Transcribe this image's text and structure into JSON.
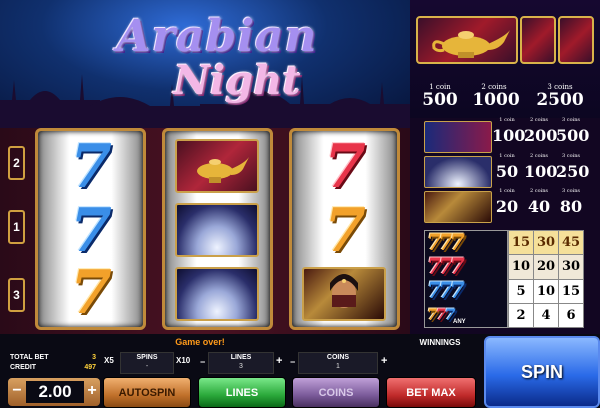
{
  "logo": {
    "line1": "Arabian",
    "line2": "Night"
  },
  "paytable_top": {
    "symbol": "magic-lamp",
    "payouts": [
      {
        "label": "1 coin",
        "value": "500"
      },
      {
        "label": "2 coins",
        "value": "1000"
      },
      {
        "label": "3 coins",
        "value": "2500"
      }
    ]
  },
  "paytable_rows": [
    {
      "symbol": "flying-carpet",
      "labels": [
        "1 coin",
        "2 coins",
        "3 coins"
      ],
      "values": [
        "100",
        "200",
        "500"
      ]
    },
    {
      "symbol": "arch",
      "labels": [
        "1 coin",
        "2 coins",
        "3 coins"
      ],
      "values": [
        "50",
        "100",
        "250"
      ]
    },
    {
      "symbol": "princess",
      "labels": [
        "1 coin",
        "2 coins",
        "3 coins"
      ],
      "values": [
        "20",
        "40",
        "80"
      ]
    }
  ],
  "sevens_table": {
    "rows": [
      {
        "values": [
          "15",
          "30",
          "45"
        ]
      },
      {
        "values": [
          "10",
          "20",
          "30"
        ]
      },
      {
        "values": [
          "5",
          "10",
          "15"
        ]
      },
      {
        "values": [
          "2",
          "4",
          "6"
        ]
      }
    ],
    "any_label": "ANY",
    "colors": {
      "gold": "#f2a12a",
      "red": "#e8344a",
      "blue": "#3a8ee8"
    }
  },
  "line_markers": [
    "2",
    "1",
    "3"
  ],
  "reels": [
    [
      "seven-blue",
      "seven-blue",
      "seven-gold"
    ],
    [
      "magic-lamp",
      "arch",
      "arch"
    ],
    [
      "seven-red",
      "seven-gold",
      "princess"
    ]
  ],
  "seven_glyph": "7",
  "status": "Game over!",
  "info": {
    "total_bet_label": "TOTAL BET",
    "total_bet": "3",
    "credit_label": "CREDIT",
    "credit": "497"
  },
  "multipliers": {
    "x5": "X5",
    "x10": "X10"
  },
  "selectors": {
    "spins": {
      "label": "SPINS",
      "value": "-"
    },
    "lines": {
      "label": "LINES",
      "value": "3"
    },
    "coins": {
      "label": "COINS",
      "value": "1"
    }
  },
  "stake": {
    "minus": "−",
    "value": "2.00",
    "plus": "+"
  },
  "buttons": {
    "autospin": "AUTOSPIN",
    "lines": "LINES",
    "coins": "COINS",
    "bet_max": "BET MAX",
    "spin": "SPIN"
  },
  "winnings_label": "WINNINGS"
}
